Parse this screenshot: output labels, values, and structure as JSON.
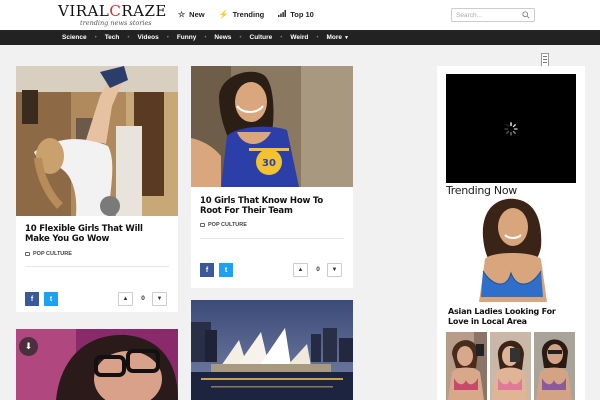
{
  "header": {
    "logo": {
      "brand_a": "VIRAL",
      "brand_c": "C",
      "brand_b": "RAZE",
      "tagline": "trending news stories"
    },
    "nav": [
      {
        "icon": "star-icon",
        "label": "New"
      },
      {
        "icon": "bolt-icon",
        "label": "Trending"
      },
      {
        "icon": "bar-chart-icon",
        "label": "Top 10"
      }
    ],
    "search": {
      "placeholder": "Search..."
    }
  },
  "categories": [
    "Science",
    "Tech",
    "Videos",
    "Funny",
    "News",
    "Culture",
    "Weird",
    "More"
  ],
  "cards": [
    {
      "title": "10 Flexible Girls That Will Make You Go Wow",
      "category": "POP CULTURE",
      "votes": "0",
      "share_fb": "f",
      "share_tw": "t"
    },
    {
      "title": "10 Girls That Know How To Root For Their Team",
      "category": "POP CULTURE",
      "votes": "0",
      "share_fb": "f",
      "share_tw": "t"
    }
  ],
  "sidebar": {
    "trending_heading": "Trending Now",
    "trending_title": "Asian Ladies Looking For Love in Local Area"
  },
  "colors": {
    "accent": "#d62a2a",
    "catbar": "#222222",
    "facebook": "#3b5998",
    "twitter": "#1da1f2"
  }
}
